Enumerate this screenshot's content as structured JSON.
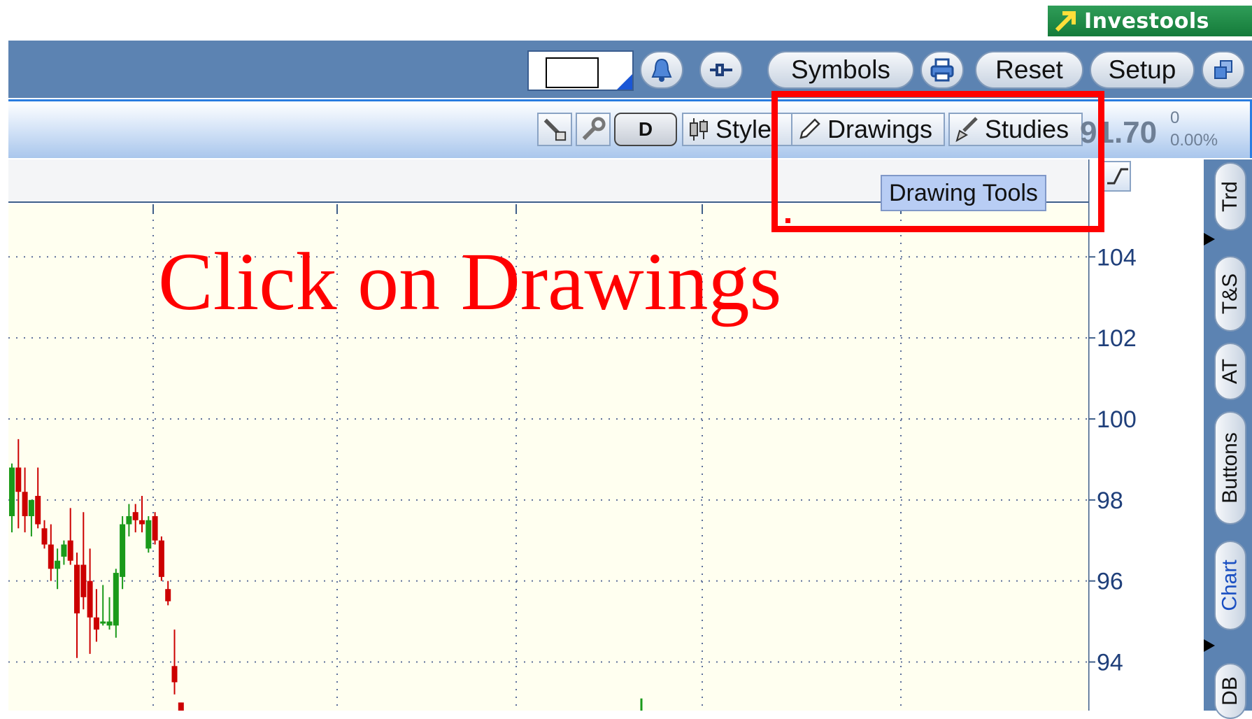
{
  "brand": {
    "name": "Investools",
    "icon": "arrow-up-right-icon"
  },
  "toolbar": {
    "symbols_label": "Symbols",
    "reset_label": "Reset",
    "setup_label": "Setup"
  },
  "chart_toolbar": {
    "period_label": "D",
    "style_label": "Style",
    "drawings_label": "Drawings",
    "studies_label": "Studies",
    "price": "91.70",
    "change": "0",
    "change_pct": "0.00%"
  },
  "tooltip": "Drawing Tools",
  "instruction": "Click on Drawings",
  "side_tabs": [
    "Trd",
    "T&S",
    "AT",
    "Buttons",
    "Chart",
    "DB"
  ],
  "active_side_tab": "Chart",
  "colors": {
    "accent": "#5c83b2",
    "up": "#1a9a1a",
    "down": "#cc0000",
    "annotation": "#ff0000",
    "chart_bg": "#fffff0"
  },
  "chart_data": {
    "type": "candlestick",
    "y_ticks": [
      "104",
      "102",
      "100",
      "98",
      "96",
      "94"
    ],
    "ylim": [
      92.8,
      105.3
    ],
    "grid": true,
    "candles": [
      {
        "o": 97.6,
        "h": 98.9,
        "l": 97.2,
        "c": 98.8
      },
      {
        "o": 98.8,
        "h": 99.5,
        "l": 97.3,
        "c": 98.2
      },
      {
        "o": 98.2,
        "h": 98.8,
        "l": 97.2,
        "c": 97.6
      },
      {
        "o": 97.6,
        "h": 98.0,
        "l": 97.1,
        "c": 98.0
      },
      {
        "o": 98.1,
        "h": 98.8,
        "l": 97.3,
        "c": 97.4
      },
      {
        "o": 97.3,
        "h": 97.5,
        "l": 96.8,
        "c": 96.9
      },
      {
        "o": 96.9,
        "h": 97.4,
        "l": 96.0,
        "c": 96.3
      },
      {
        "o": 96.3,
        "h": 96.8,
        "l": 95.8,
        "c": 96.5
      },
      {
        "o": 96.6,
        "h": 97.0,
        "l": 96.4,
        "c": 96.9
      },
      {
        "o": 97.0,
        "h": 97.8,
        "l": 96.4,
        "c": 96.5
      },
      {
        "o": 96.4,
        "h": 96.7,
        "l": 94.1,
        "c": 95.2
      },
      {
        "o": 96.4,
        "h": 97.7,
        "l": 95.3,
        "c": 95.6
      },
      {
        "o": 96.0,
        "h": 96.8,
        "l": 94.2,
        "c": 95.1
      },
      {
        "o": 95.1,
        "h": 95.8,
        "l": 94.5,
        "c": 94.8
      },
      {
        "o": 95.0,
        "h": 95.9,
        "l": 94.9,
        "c": 95.0
      },
      {
        "o": 94.9,
        "h": 95.6,
        "l": 94.8,
        "c": 95.0
      },
      {
        "o": 94.9,
        "h": 96.3,
        "l": 94.6,
        "c": 96.2
      },
      {
        "o": 96.1,
        "h": 97.6,
        "l": 95.8,
        "c": 97.4
      },
      {
        "o": 97.4,
        "h": 97.9,
        "l": 97.1,
        "c": 97.6
      },
      {
        "o": 97.7,
        "h": 97.9,
        "l": 97.2,
        "c": 97.5
      },
      {
        "o": 97.5,
        "h": 98.1,
        "l": 97.2,
        "c": 97.4
      },
      {
        "o": 96.8,
        "h": 97.6,
        "l": 96.7,
        "c": 97.5
      },
      {
        "o": 97.6,
        "h": 97.7,
        "l": 96.9,
        "c": 97.0
      },
      {
        "o": 97.0,
        "h": 97.1,
        "l": 96.0,
        "c": 96.1
      },
      {
        "o": 95.8,
        "h": 96.0,
        "l": 95.4,
        "c": 95.5
      },
      {
        "o": 93.9,
        "h": 94.8,
        "l": 93.2,
        "c": 93.5
      },
      {
        "o": 93.0,
        "h": 93.0,
        "l": 92.8,
        "c": 92.8
      }
    ]
  }
}
